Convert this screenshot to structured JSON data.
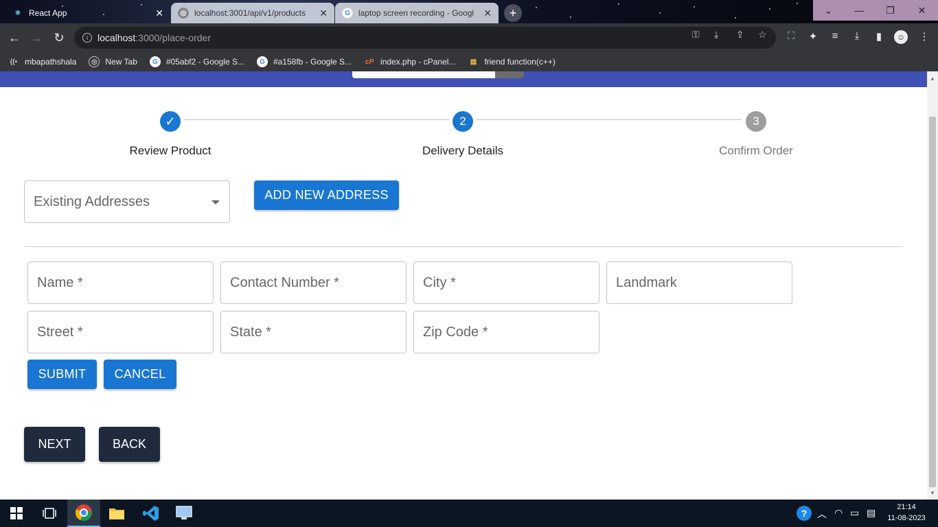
{
  "browser": {
    "tabs": [
      {
        "title": "React App",
        "active": true
      },
      {
        "title": "localhost:3001/api/v1/products",
        "active": false
      },
      {
        "title": "laptop screen recording - Googl",
        "active": false
      }
    ],
    "new_tab_symbol": "+",
    "url_host": "localhost",
    "url_rest": ":3000/place-order",
    "bookmarks": [
      {
        "label": "mbapathshala",
        "icon": "radio-wave-icon"
      },
      {
        "label": "New Tab",
        "icon": "globe-icon"
      },
      {
        "label": "#05abf2 - Google S...",
        "icon": "google-icon"
      },
      {
        "label": "#a158fb - Google S...",
        "icon": "google-icon"
      },
      {
        "label": "index.php - cPanel...",
        "icon": "cpanel-icon"
      },
      {
        "label": "friend function(c++)",
        "icon": "document-icon"
      }
    ]
  },
  "stepper": {
    "steps": [
      {
        "number": "1",
        "label": "Review Product",
        "state": "completed"
      },
      {
        "number": "2",
        "label": "Delivery Details",
        "state": "active"
      },
      {
        "number": "3",
        "label": "Confirm Order",
        "state": "disabled"
      }
    ],
    "colors": {
      "active": "#1976d2",
      "disabled": "#9e9e9e"
    }
  },
  "address": {
    "select_label": "Existing Addresses",
    "add_button": "ADD NEW ADDRESS"
  },
  "form": {
    "name": "Name *",
    "contact": "Contact Number *",
    "city": "City *",
    "landmark": "Landmark",
    "street": "Street *",
    "state": "State *",
    "zip": "Zip Code *",
    "submit": "SUBMIT",
    "cancel": "CANCEL"
  },
  "nav": {
    "next": "NEXT",
    "back": "BACK"
  },
  "taskbar": {
    "time": "21:14",
    "date": "11-08-2023"
  }
}
